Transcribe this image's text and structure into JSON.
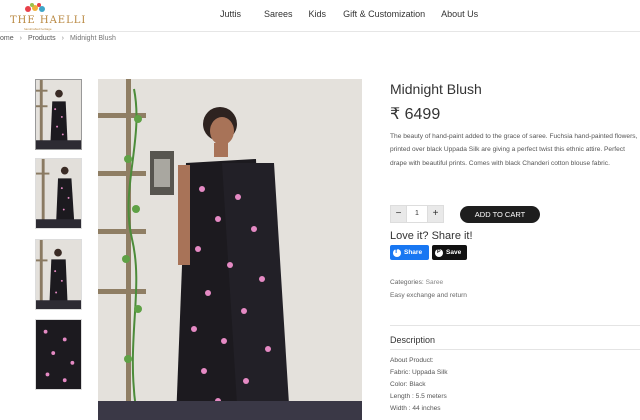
{
  "brand": {
    "name": "THE HAELLI",
    "tagline": "handcrafted heritage"
  },
  "nav": {
    "items": [
      "Juttis",
      "Sarees",
      "Kids",
      "Gift & Customization",
      "About Us"
    ]
  },
  "breadcrumb": {
    "items": [
      "ome",
      "Products",
      "Midnight Blush"
    ],
    "separator": "›"
  },
  "gallery": {
    "thumbnail_count": 4,
    "background_color": "#e4e1dc",
    "saree_color": "#1c1a1f",
    "flower_color": "#e58ac4"
  },
  "product": {
    "title": "Midnight Blush",
    "price": "₹ 6499",
    "description": "The beauty of hand-paint added to the grace of saree. Fuchsia hand-painted flowers, printed over black Uppada Silk are giving a perfect twist this ethnic attire. Perfect drape with beautiful prints. Comes with black Chanderi cotton blouse fabric.",
    "quantity": "1",
    "minus_label": "−",
    "plus_label": "+",
    "add_to_cart": "ADD TO CART"
  },
  "share": {
    "heading": "Love it? Share it!",
    "facebook_label": "Share",
    "pinterest_label": "Save",
    "facebook_color": "#1877f2"
  },
  "meta": {
    "categories_label": "Categories:",
    "category": "Saree",
    "easy_exchange": "Easy exchange and return"
  },
  "details": {
    "heading": "Description",
    "lines": [
      "About Product:",
      "Fabric: Uppada Silk",
      "Color: Black",
      "Length : 5.5 meters",
      "Width : 44 inches"
    ]
  }
}
